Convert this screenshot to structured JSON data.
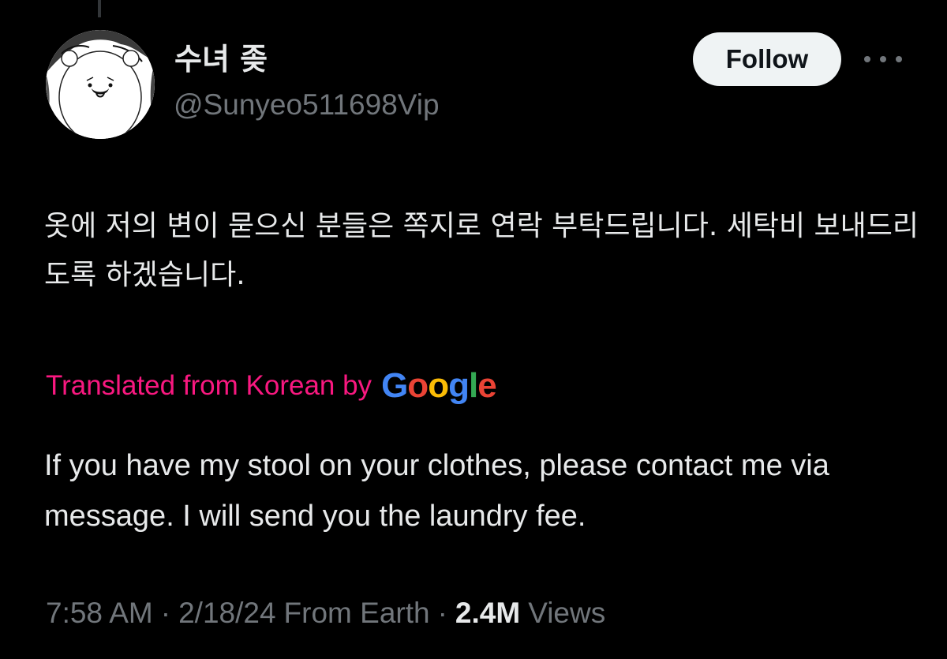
{
  "author": {
    "display_name": "수녀 좆",
    "handle": "@Sunyeo511698Vip",
    "avatar_icon": "bear-avatar"
  },
  "actions": {
    "follow_label": "Follow",
    "more_icon": "more-horizontal-icon"
  },
  "tweet": {
    "original_text": "옷에 저의 변이 묻으신 분들은 쪽지로 연락 부탁드립니다. 세탁비 보내드리도록 하겠습니다.",
    "translation_label": "Translated from Korean by",
    "translation_provider": {
      "letters": [
        "G",
        "o",
        "o",
        "g",
        "l",
        "e"
      ],
      "colors": [
        "#4285F4",
        "#EA4335",
        "#FBBC05",
        "#4285F4",
        "#34A853",
        "#EA4335"
      ]
    },
    "translated_text": "If you have my stool on your clothes, please contact me via message. I will send you the laundry fee."
  },
  "meta": {
    "time": "7:58 AM",
    "separator": "·",
    "date": "2/18/24",
    "source": "From Earth",
    "views_count": "2.4M",
    "views_label": "Views"
  },
  "colors": {
    "background": "#000000",
    "text_primary": "#e7e9ea",
    "text_secondary": "#71767b",
    "translate_accent": "#f91880",
    "follow_bg": "#eff3f4"
  }
}
